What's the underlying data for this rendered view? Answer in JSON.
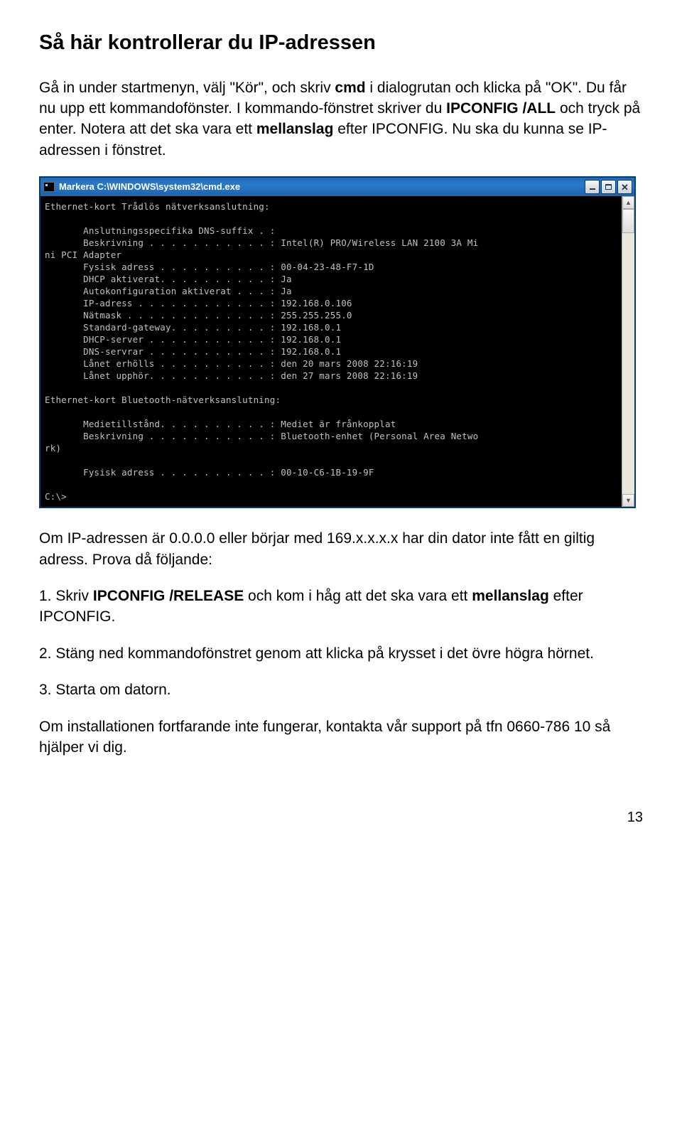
{
  "title": "Så här kontrollerar du IP-adressen",
  "para1_pre": "Gå in under startmenyn, välj \"Kör\", och skriv ",
  "para1_cmd": "cmd",
  "para1_mid": " i dialogrutan och klicka på \"OK\". Du får nu upp ett kommandofönster. I kommando-fönstret skriver du ",
  "para1_bold1": "IPCONFIG /ALL",
  "para1_mid2": " och tryck på enter. Notera att det ska vara ett ",
  "para1_bold2": "mellanslag",
  "para1_end": " efter IPCONFIG. Nu ska du kunna se IP-adressen i fönstret.",
  "cmd_window_title": "Markera C:\\WINDOWS\\system32\\cmd.exe",
  "cmd_lines": {
    "sect1": "Ethernet-kort Trådlös nätverksanslutning:",
    "l1": "Anslutningsspecifika DNS-suffix . :",
    "l2": "Beskrivning . . . . . . . . . . . : Intel(R) PRO/Wireless LAN 2100 3A Mi",
    "l2b": "ni PCI Adapter",
    "l3": "Fysisk adress . . . . . . . . . . : 00-04-23-48-F7-1D",
    "l4": "DHCP aktiverat. . . . . . . . . . : Ja",
    "l5": "Autokonfiguration aktiverat . . . : Ja",
    "l6": "IP-adress . . . . . . . . . . . . : 192.168.0.106",
    "l7": "Nätmask . . . . . . . . . . . . . : 255.255.255.0",
    "l8": "Standard-gateway. . . . . . . . . : 192.168.0.1",
    "l9": "DHCP-server . . . . . . . . . . . : 192.168.0.1",
    "l10": "DNS-servrar . . . . . . . . . . . : 192.168.0.1",
    "l11": "Lånet erhölls . . . . . . . . . . : den 20 mars 2008 22:16:19",
    "l12": "Lånet upphör. . . . . . . . . . . : den 27 mars 2008 22:16:19",
    "sect2": "Ethernet-kort Bluetooth-nätverksanslutning:",
    "l13": "Medietillstånd. . . . . . . . . . : Mediet är frånkopplat",
    "l14": "Beskrivning . . . . . . . . . . . : Bluetooth-enhet (Personal Area Netwo",
    "l14b": "rk)",
    "l15": "Fysisk adress . . . . . . . . . . : 00-10-C6-1B-19-9F",
    "prompt": "C:\\>"
  },
  "para2": "Om IP-adressen är 0.0.0.0 eller börjar med 169.x.x.x.x har din dator inte fått en giltig adress. Prova då följande:",
  "step1_pre": "1. Skriv ",
  "step1_bold1": "IPCONFIG /RELEASE",
  "step1_mid": " och kom i håg att det ska vara ett ",
  "step1_bold2": "mellanslag",
  "step1_end": " efter IPCONFIG.",
  "step2": "2. Stäng ned kommandofönstret genom att klicka på krysset i det övre högra hörnet.",
  "step3": "3. Starta om datorn.",
  "para_support": "Om installationen fortfarande inte fungerar, kontakta vår support på tfn 0660-786 10 så hjälper vi dig.",
  "page_number": "13"
}
